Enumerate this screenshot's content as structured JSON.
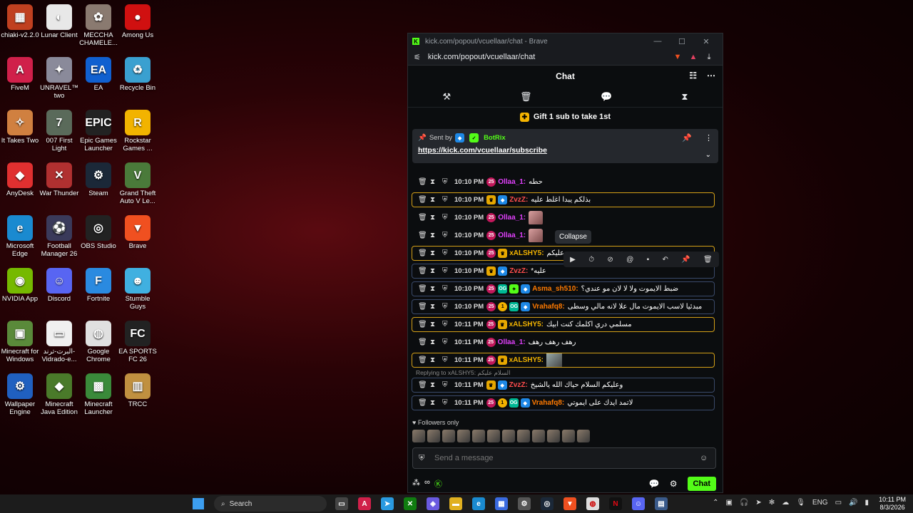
{
  "desktop": {
    "icons": [
      {
        "label": "chiaki-v2.2.0",
        "color": "#c04020",
        "glyph": "▦"
      },
      {
        "label": "Lunar Client",
        "color": "#e8e8e8",
        "glyph": "◐"
      },
      {
        "label": "MECCHA CHAMELE...",
        "color": "#8a7a70",
        "glyph": "✿"
      },
      {
        "label": "Among Us",
        "color": "#d01010",
        "glyph": "●"
      },
      {
        "label": "FiveM",
        "color": "#d0204a",
        "glyph": "A"
      },
      {
        "label": "UNRAVEL™ two",
        "color": "#8a8a9a",
        "glyph": "✦"
      },
      {
        "label": "EA",
        "color": "#1060d0",
        "glyph": "EA"
      },
      {
        "label": "Recycle Bin",
        "color": "#3aa0d0",
        "glyph": "♻"
      },
      {
        "label": "It Takes Two",
        "color": "#d08040",
        "glyph": "✧"
      },
      {
        "label": "007 First Light",
        "color": "#5a6a5a",
        "glyph": "7"
      },
      {
        "label": "Epic Games Launcher",
        "color": "#222222",
        "glyph": "EPIC"
      },
      {
        "label": "Rockstar Games ...",
        "color": "#f2b300",
        "glyph": "R"
      },
      {
        "label": "AnyDesk",
        "color": "#e03030",
        "glyph": "◆"
      },
      {
        "label": "War Thunder",
        "color": "#b03030",
        "glyph": "✕"
      },
      {
        "label": "Steam",
        "color": "#1b2838",
        "glyph": "⚙"
      },
      {
        "label": "Grand Theft Auto V Le...",
        "color": "#4a7a3a",
        "glyph": "V"
      },
      {
        "label": "Microsoft Edge",
        "color": "#1a8ad0",
        "glyph": "e"
      },
      {
        "label": "Football Manager 26",
        "color": "#3a3a5a",
        "glyph": "⚽"
      },
      {
        "label": "OBS Studio",
        "color": "#222222",
        "glyph": "◎"
      },
      {
        "label": "Brave",
        "color": "#f05020",
        "glyph": "▼"
      },
      {
        "label": "NVIDIA App",
        "color": "#76b900",
        "glyph": "◉"
      },
      {
        "label": "Discord",
        "color": "#5865f2",
        "glyph": "☺"
      },
      {
        "label": "Fortnite",
        "color": "#2a8ae0",
        "glyph": "F"
      },
      {
        "label": "Stumble Guys",
        "color": "#40b0e0",
        "glyph": "☻"
      },
      {
        "label": "Minecraft for Windows",
        "color": "#5a8a3a",
        "glyph": "▣"
      },
      {
        "label": "البرت-ترند-Vidrado-e...",
        "color": "#f0f0f0",
        "glyph": "▭"
      },
      {
        "label": "Google Chrome",
        "color": "#e0e0e0",
        "glyph": "◍"
      },
      {
        "label": "EA SPORTS FC 26",
        "color": "#222222",
        "glyph": "FC"
      },
      {
        "label": "Wallpaper Engine",
        "color": "#2060c0",
        "glyph": "⚙"
      },
      {
        "label": "Minecraft Java Edition",
        "color": "#4a7a2a",
        "glyph": "◆"
      },
      {
        "label": "Minecraft Launcher",
        "color": "#3a8a3a",
        "glyph": "▩"
      },
      {
        "label": "TRCC",
        "color": "#c09040",
        "glyph": "▥"
      }
    ]
  },
  "browser": {
    "title": "kick.com/popout/vcuellaar/chat - Brave",
    "url": "kick.com/popout/vcuellaar/chat"
  },
  "chat": {
    "header": "Chat",
    "gift_banner": "Gift 1 sub to take 1st",
    "pinned": {
      "sent_by": "Sent by",
      "bot_name": "BotRix",
      "link": "https://kick.com/vcuellaar/subscribe"
    },
    "tooltip": "Collapse",
    "messages": [
      {
        "time": "10:10 PM",
        "badges": [
          "sub"
        ],
        "user": "Ollaa_1:",
        "user_color": "#e040fb",
        "text": "حطه",
        "type": "text",
        "hl": ""
      },
      {
        "time": "10:10 PM",
        "badges": [
          "crown",
          "blue"
        ],
        "user": "ZvzZ:",
        "user_color": "#ff4d4d",
        "text": "بذلكم يبدا اغلط عليه",
        "type": "text",
        "hl": "hl"
      },
      {
        "time": "10:10 PM",
        "badges": [
          "sub"
        ],
        "user": "Ollaa_1:",
        "user_color": "#e040fb",
        "text": "",
        "type": "emote",
        "hl": ""
      },
      {
        "time": "10:10 PM",
        "badges": [
          "sub"
        ],
        "user": "Ollaa_1:",
        "user_color": "#e040fb",
        "text": "",
        "type": "emote",
        "hl": ""
      },
      {
        "time": "10:10 PM",
        "badges": [
          "sub",
          "crown"
        ],
        "user": "xALSHY5:",
        "user_color": "#f2b300",
        "text": "م عليكم",
        "type": "text",
        "hl": "hl"
      },
      {
        "time": "10:10 PM",
        "badges": [
          "crown",
          "blue"
        ],
        "user": "ZvzZ:",
        "user_color": "#ff4d4d",
        "text": "*عليه",
        "type": "text",
        "hl": "hl2"
      },
      {
        "time": "10:10 PM",
        "badges": [
          "sub",
          "og",
          "verified",
          "blue"
        ],
        "user": "Asma_sh510:",
        "user_color": "#ff7a00",
        "text": "ضبط الايموت ولا لا لان مو عندي؟",
        "type": "text",
        "hl": "hl2"
      },
      {
        "time": "10:10 PM",
        "badges": [
          "sub",
          "gold",
          "og",
          "blue"
        ],
        "user": "Vrahafq8:",
        "user_color": "#ff7a00",
        "text": "مبدئيا لاسب الايموت مال علا لانه مالي وسطى",
        "type": "text",
        "hl": "hl2"
      },
      {
        "time": "10:11 PM",
        "badges": [
          "sub",
          "crown"
        ],
        "user": "xALSHY5:",
        "user_color": "#f2b300",
        "text": "مسلمي دري اكلمك كنت ابيك",
        "type": "text",
        "hl": "hl"
      },
      {
        "time": "10:11 PM",
        "badges": [
          "sub"
        ],
        "user": "Ollaa_1:",
        "user_color": "#e040fb",
        "text": "رهف رهف رهف",
        "type": "text",
        "hl": ""
      },
      {
        "time": "10:11 PM",
        "badges": [
          "sub",
          "crown"
        ],
        "user": "xALSHY5:",
        "user_color": "#f2b300",
        "text": "",
        "type": "emote2",
        "hl": "hl"
      },
      {
        "time": "10:11 PM",
        "badges": [
          "crown",
          "blue"
        ],
        "user": "ZvzZ:",
        "user_color": "#ff4d4d",
        "text": "وعليكم السلام حياك الله يالشيخ",
        "type": "text",
        "hl": "hl2",
        "reply": "Replying to xALSHY5: السلام عليكم"
      },
      {
        "time": "10:11 PM",
        "badges": [
          "sub",
          "gold",
          "og",
          "blue"
        ],
        "user": "Vrahafq8:",
        "user_color": "#ff7a00",
        "text": "لاتمد ايدك على ايموتي",
        "type": "text",
        "hl": "hl2"
      }
    ],
    "followers_only": "Followers only",
    "compose_placeholder": "Send a message",
    "send_label": "Chat"
  },
  "taskbar": {
    "search": "Search",
    "lang": "ENG",
    "time": "10:11 PM",
    "date": "8/3/2026"
  }
}
